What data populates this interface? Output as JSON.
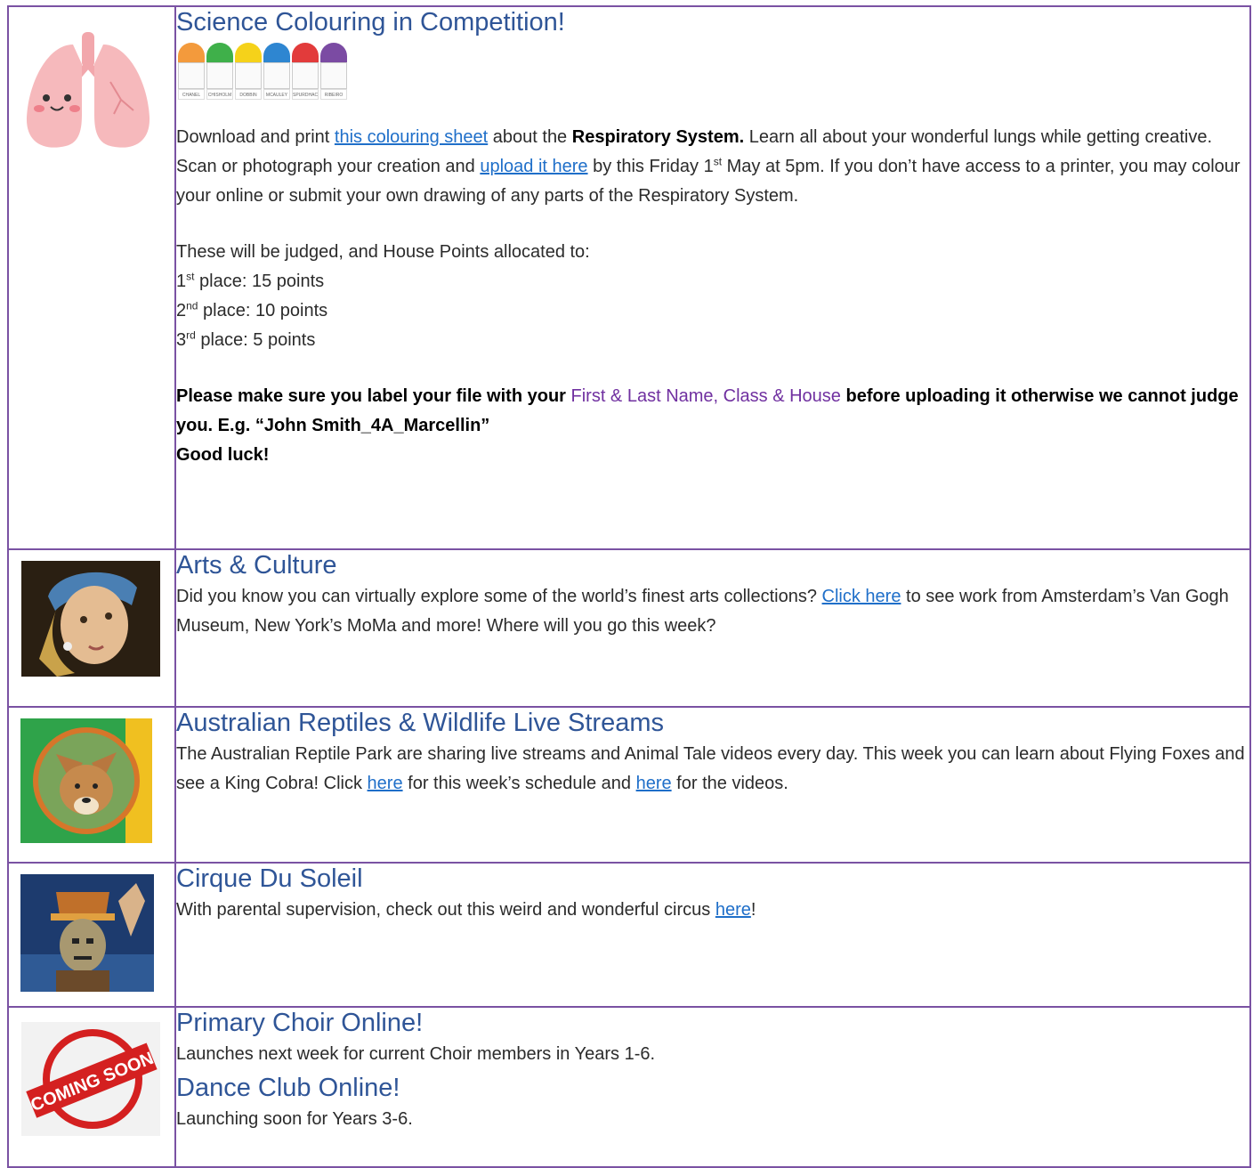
{
  "rows": [
    {
      "image_icon": "lungs-icon",
      "title": "Science Colouring in Competition!",
      "houses": [
        {
          "name": "CHANEL",
          "color": "#f39a3c"
        },
        {
          "name": "CHISHOLM",
          "color": "#3fb04a"
        },
        {
          "name": "DOBBIN",
          "color": "#f5d21a"
        },
        {
          "name": "MCAULEY",
          "color": "#2e86d1"
        },
        {
          "name": "SPURDHACK",
          "color": "#e23b3b"
        },
        {
          "name": "RIBEIRO",
          "color": "#7b4ba3"
        }
      ],
      "para1": {
        "t1": "Download and print ",
        "link1": "this colouring sheet",
        "t2": " about the ",
        "bold1": "Respiratory System.",
        "t3": " Learn all about your wonderful lungs while getting creative. Scan or photograph your creation and ",
        "link2": "upload it here",
        "t4": " by this Friday 1",
        "sup1": "st",
        "t5": " May at 5pm. If you don’t have access to a printer, you may colour your online or submit your own drawing of any parts of the Respiratory System."
      },
      "judged": "These will be judged, and House Points allocated to:",
      "places": [
        {
          "num": "1",
          "sup": "st",
          "text": " place: 15 points"
        },
        {
          "num": "2",
          "sup": "nd",
          "text": " place: 10 points"
        },
        {
          "num": "3",
          "sup": "rd",
          "text": " place: 5 points"
        }
      ],
      "note": {
        "b1": "Please make sure you label your file with your ",
        "purple": "First & Last Name, Class & House",
        "b2": " before uploading it otherwise we cannot judge you. E.g. “John Smith_4A_Marcellin”",
        "b3": "Good luck!"
      }
    },
    {
      "image_icon": "girl-pearl-earring-painting-icon",
      "title": "Arts & Culture",
      "t1": "Did you know you can virtually explore some of the world’s finest arts collections? ",
      "link1": "Click here",
      "t2": " to see work from Amsterdam’s Van Gogh Museum, New York’s MoMa and more! Where will you go this week?"
    },
    {
      "image_icon": "dingo-icon",
      "title": "Australian Reptiles & Wildlife Live Streams",
      "t1": "The Australian Reptile Park are sharing live streams and Animal Tale videos every day. This week you can learn about Flying Foxes and see a King Cobra! Click ",
      "link1": "here",
      "t2": " for this week’s schedule and ",
      "link2": "here",
      "t3": " for the videos."
    },
    {
      "image_icon": "circus-performer-icon",
      "title": "Cirque Du Soleil",
      "t1": "With parental supervision, check out this weird and wonderful circus ",
      "link1": "here",
      "t2": "!"
    },
    {
      "image_icon": "coming-soon-stamp-icon",
      "stamp_text": "COMING SOON",
      "title1": "Primary Choir Online!",
      "text1": "Launches next week for current Choir members in Years 1-6.",
      "title2": "Dance Club Online!",
      "text2": "Launching soon for Years 3-6."
    }
  ],
  "colors": {
    "border": "#7a52a3",
    "title": "#2f5597",
    "link": "#1f6fc9",
    "highlight": "#7030a0"
  }
}
